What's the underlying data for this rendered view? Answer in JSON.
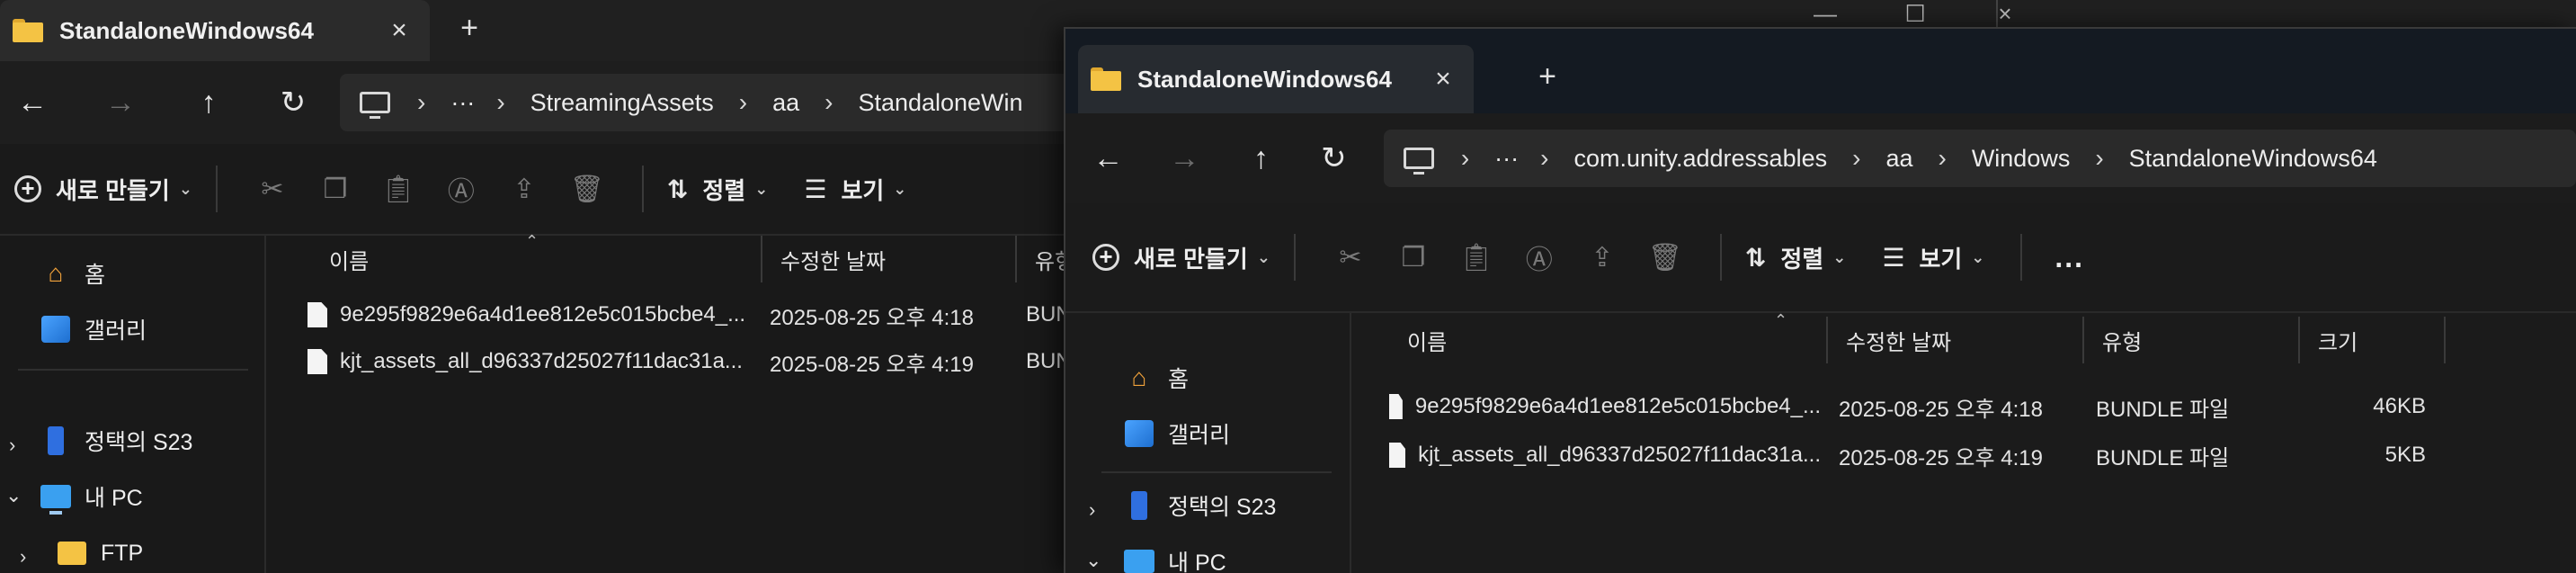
{
  "window_back": {
    "tab_title": "StandaloneWindows64",
    "breadcrumbs": [
      "StreamingAssets",
      "aa",
      "StandaloneWin"
    ],
    "toolbar": {
      "new_label": "새로 만들기",
      "sort_label": "정렬",
      "view_label": "보기"
    },
    "nav": {
      "home": "홈",
      "gallery": "갤러리",
      "phone": "정택의 S23",
      "pc": "내 PC",
      "ftp": "FTP"
    },
    "columns": {
      "name": "이름",
      "modified": "수정한 날짜",
      "type": "유형"
    },
    "files": [
      {
        "name": "9e295f9829e6a4d1ee812e5c015bcbe4_...",
        "modified": "2025-08-25 오후 4:18",
        "type": "BUN"
      },
      {
        "name": "kjt_assets_all_d96337d25027f11dac31a...",
        "modified": "2025-08-25 오후 4:19",
        "type": "BUN"
      }
    ]
  },
  "window_front": {
    "tab_title": "StandaloneWindows64",
    "breadcrumbs": [
      "com.unity.addressables",
      "aa",
      "Windows",
      "StandaloneWindows64"
    ],
    "toolbar": {
      "new_label": "새로 만들기",
      "sort_label": "정렬",
      "view_label": "보기",
      "more_label": "..."
    },
    "nav": {
      "home": "홈",
      "gallery": "갤러리",
      "phone": "정택의 S23",
      "pc": "내 PC"
    },
    "columns": {
      "name": "이름",
      "modified": "수정한 날짜",
      "type": "유형",
      "size": "크기"
    },
    "files": [
      {
        "name": "9e295f9829e6a4d1ee812e5c015bcbe4_...",
        "modified": "2025-08-25 오후 4:18",
        "type": "BUNDLE 파일",
        "size": "46KB"
      },
      {
        "name": "kjt_assets_all_d96337d25027f11dac31a...",
        "modified": "2025-08-25 오후 4:19",
        "type": "BUNDLE 파일",
        "size": "5KB"
      }
    ]
  },
  "icons": {
    "close": "×",
    "plus": "+",
    "back": "←",
    "forward": "→",
    "up": "↑",
    "refresh": "↻",
    "chevron": "›",
    "chevron_down": "⌄",
    "expand": "›",
    "collapse": "⌄",
    "ellipsis": "···"
  },
  "colors": {
    "folder": "#f4c344",
    "accent": "#3aa0f0",
    "background": "#191919"
  }
}
